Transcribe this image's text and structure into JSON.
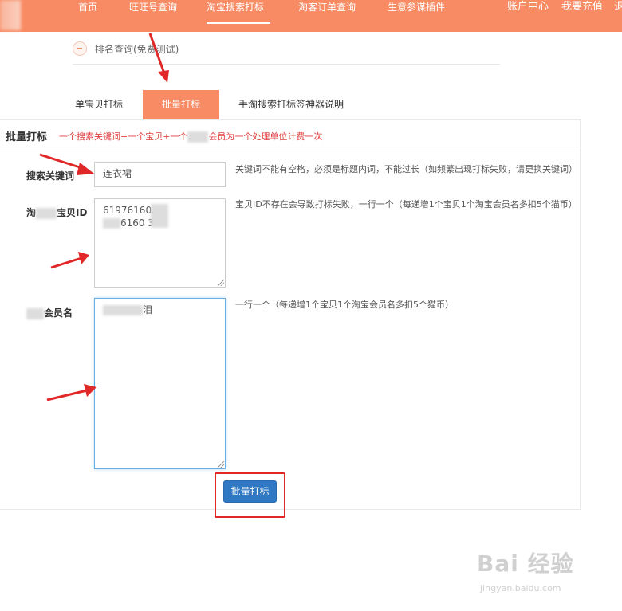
{
  "nav": {
    "items": [
      "首页",
      "旺旺号查询",
      "淘宝搜索打标",
      "淘客订单查询",
      "生意参谋插件"
    ],
    "active_index": 2,
    "right_items": [
      "账户中心",
      "我要充值",
      "退"
    ]
  },
  "breadcrumb": {
    "text": "排名查询(免费测试)"
  },
  "tabs": [
    "单宝贝打标",
    "批量打标",
    "手淘搜索打标签神器说明"
  ],
  "panel": {
    "title": "批量打标",
    "note_part1": "一个搜索关键词+一个宝贝+一个",
    "note_part2": "会员为一个处理单位计费一次"
  },
  "form": {
    "keyword_label": "搜索关键词",
    "keyword_value": "连衣裙",
    "keyword_hint": "关键词不能有空格，必须是标题内词，不能过长（如频繁出现打标失败，请更换关键词）",
    "item_label_prefix": "淘",
    "item_label_suffix": "宝贝ID",
    "item_value_line1": "6197616036",
    "item_value_line2": "6160  3",
    "item_hint": "宝贝ID不存在会导致打标失败，一行一个（每递增1个宝贝1个淘宝会员名多扣5个猫币）",
    "member_label": "会员名",
    "member_value_suffix": "泪",
    "member_hint": "一行一个（每递增1个宝贝1个淘宝会员名多扣5个猫币）"
  },
  "submit_label": "批量打标",
  "watermark": {
    "text": "Bai 经验",
    "sub": "jingyan.baidu.com"
  },
  "colors": {
    "accent": "#f88b64",
    "button": "#2f79c4",
    "annotation": "#e02828",
    "note": "#e23d3d"
  }
}
